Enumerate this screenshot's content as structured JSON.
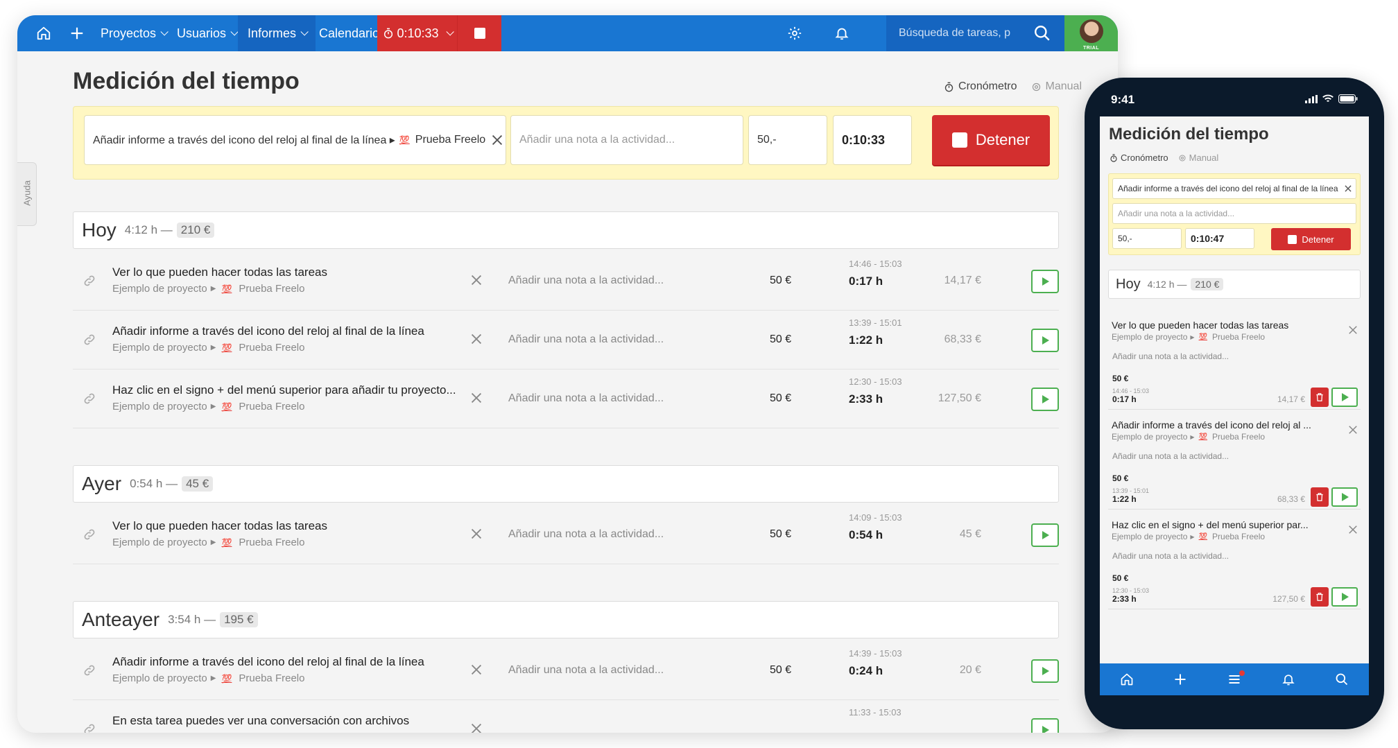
{
  "nav": {
    "projects": "Proyectos",
    "users": "Usuarios",
    "reports": "Informes",
    "calendar": "Calendario",
    "timer": "0:10:33",
    "search_placeholder": "Búsqueda de tareas, p",
    "trial": "TRIAL"
  },
  "colors": {
    "nav_blue": "#1976d2",
    "stop_red": "#d32f2f",
    "tracker_yellow": "#fff7c2",
    "play_green": "#4caf50",
    "trial_green": "#4caf50"
  },
  "help": "Ayuda",
  "page": {
    "title": "Medición del tiempo",
    "mode_stopwatch": "Cronómetro",
    "mode_manual": "Manual"
  },
  "tracker": {
    "task": "Añadir informe a través del icono del reloj al final de la línea ▸",
    "project": "Prueba Freelo",
    "note_placeholder": "Añadir una nota a la actividad...",
    "rate": "50,-",
    "elapsed": "0:10:33",
    "stop_label": "Detener"
  },
  "groups": [
    {
      "name": "Hoy",
      "hours": "4:12 h —",
      "money": "210 €",
      "rows": [
        {
          "title": "Ver lo que pueden hacer todas las tareas",
          "project": "Ejemplo de proyecto",
          "client": "Prueba Freelo",
          "note": "Añadir una nota a la actividad...",
          "rate": "50 €",
          "range": "14:46 - 15:03",
          "duration": "0:17 h",
          "amount": "14,17 €"
        },
        {
          "title": "Añadir informe a través del icono del reloj al final de la línea",
          "project": "Ejemplo de proyecto",
          "client": "Prueba Freelo",
          "note": "Añadir una nota a la actividad...",
          "rate": "50 €",
          "range": "13:39 - 15:01",
          "duration": "1:22 h",
          "amount": "68,33 €"
        },
        {
          "title": "Haz clic en el signo + del menú superior para añadir tu proyecto...",
          "project": "Ejemplo de proyecto",
          "client": "Prueba Freelo",
          "note": "Añadir una nota a la actividad...",
          "rate": "50 €",
          "range": "12:30 - 15:03",
          "duration": "2:33 h",
          "amount": "127,50 €"
        }
      ]
    },
    {
      "name": "Ayer",
      "hours": "0:54 h —",
      "money": "45 €",
      "rows": [
        {
          "title": "Ver lo que pueden hacer todas las tareas",
          "project": "Ejemplo de proyecto",
          "client": "Prueba Freelo",
          "note": "Añadir una nota a la actividad...",
          "rate": "50 €",
          "range": "14:09 - 15:03",
          "duration": "0:54 h",
          "amount": "45 €"
        }
      ]
    },
    {
      "name": "Anteayer",
      "hours": "3:54 h —",
      "money": "195 €",
      "rows": [
        {
          "title": "Añadir informe a través del icono del reloj al final de la línea",
          "project": "Ejemplo de proyecto",
          "client": "Prueba Freelo",
          "note": "Añadir una nota a la actividad...",
          "rate": "50 €",
          "range": "14:39 - 15:03",
          "duration": "0:24 h",
          "amount": "20 €"
        },
        {
          "title": "En esta tarea puedes ver una conversación con archivos",
          "project": "",
          "client": "",
          "note": "",
          "rate": "",
          "range": "11:33 - 15:03",
          "duration": "",
          "amount": ""
        }
      ]
    }
  ],
  "phone": {
    "clock": "9:41",
    "title": "Medición del tiempo",
    "mode_stopwatch": "Cronómetro",
    "mode_manual": "Manual",
    "tracker": {
      "task": "Añadir informe a través del icono del reloj al final de la línea",
      "note_placeholder": "Añadir una nota a la actividad...",
      "rate": "50,-",
      "elapsed": "0:10:47",
      "stop_label": "Detener"
    },
    "group": {
      "name": "Hoy",
      "hours": "4:12 h —",
      "money": "210 €"
    },
    "rows": [
      {
        "title": "Ver lo que pueden hacer todas las tareas",
        "project": "Ejemplo de proyecto",
        "client": "Prueba Freelo",
        "note": "Añadir una nota a la actividad...",
        "rate": "50 €",
        "range": "14:46 - 15:03",
        "duration": "0:17 h",
        "amount": "14,17 €"
      },
      {
        "title": "Añadir informe a través del icono del reloj al ...",
        "project": "Ejemplo de proyecto",
        "client": "Prueba Freelo",
        "note": "Añadir una nota a la actividad...",
        "rate": "50 €",
        "range": "13:39 - 15:01",
        "duration": "1:22 h",
        "amount": "68,33 €"
      },
      {
        "title": "Haz clic en el signo + del menú superior par...",
        "project": "Ejemplo de proyecto",
        "client": "Prueba Freelo",
        "note": "Añadir una nota a la actividad...",
        "rate": "50 €",
        "range": "12:30 - 15:03",
        "duration": "2:33 h",
        "amount": "127,50 €"
      }
    ]
  },
  "icons": {
    "home": "home-icon",
    "add": "plus-icon",
    "settings": "gear-icon",
    "notifications": "bell-icon",
    "search": "search-icon",
    "link": "link-icon",
    "remove": "close-icon",
    "play": "play-icon",
    "delete": "trash-icon",
    "menu": "menu-icon",
    "timer": "stopwatch-icon",
    "manual": "gear-icon"
  }
}
